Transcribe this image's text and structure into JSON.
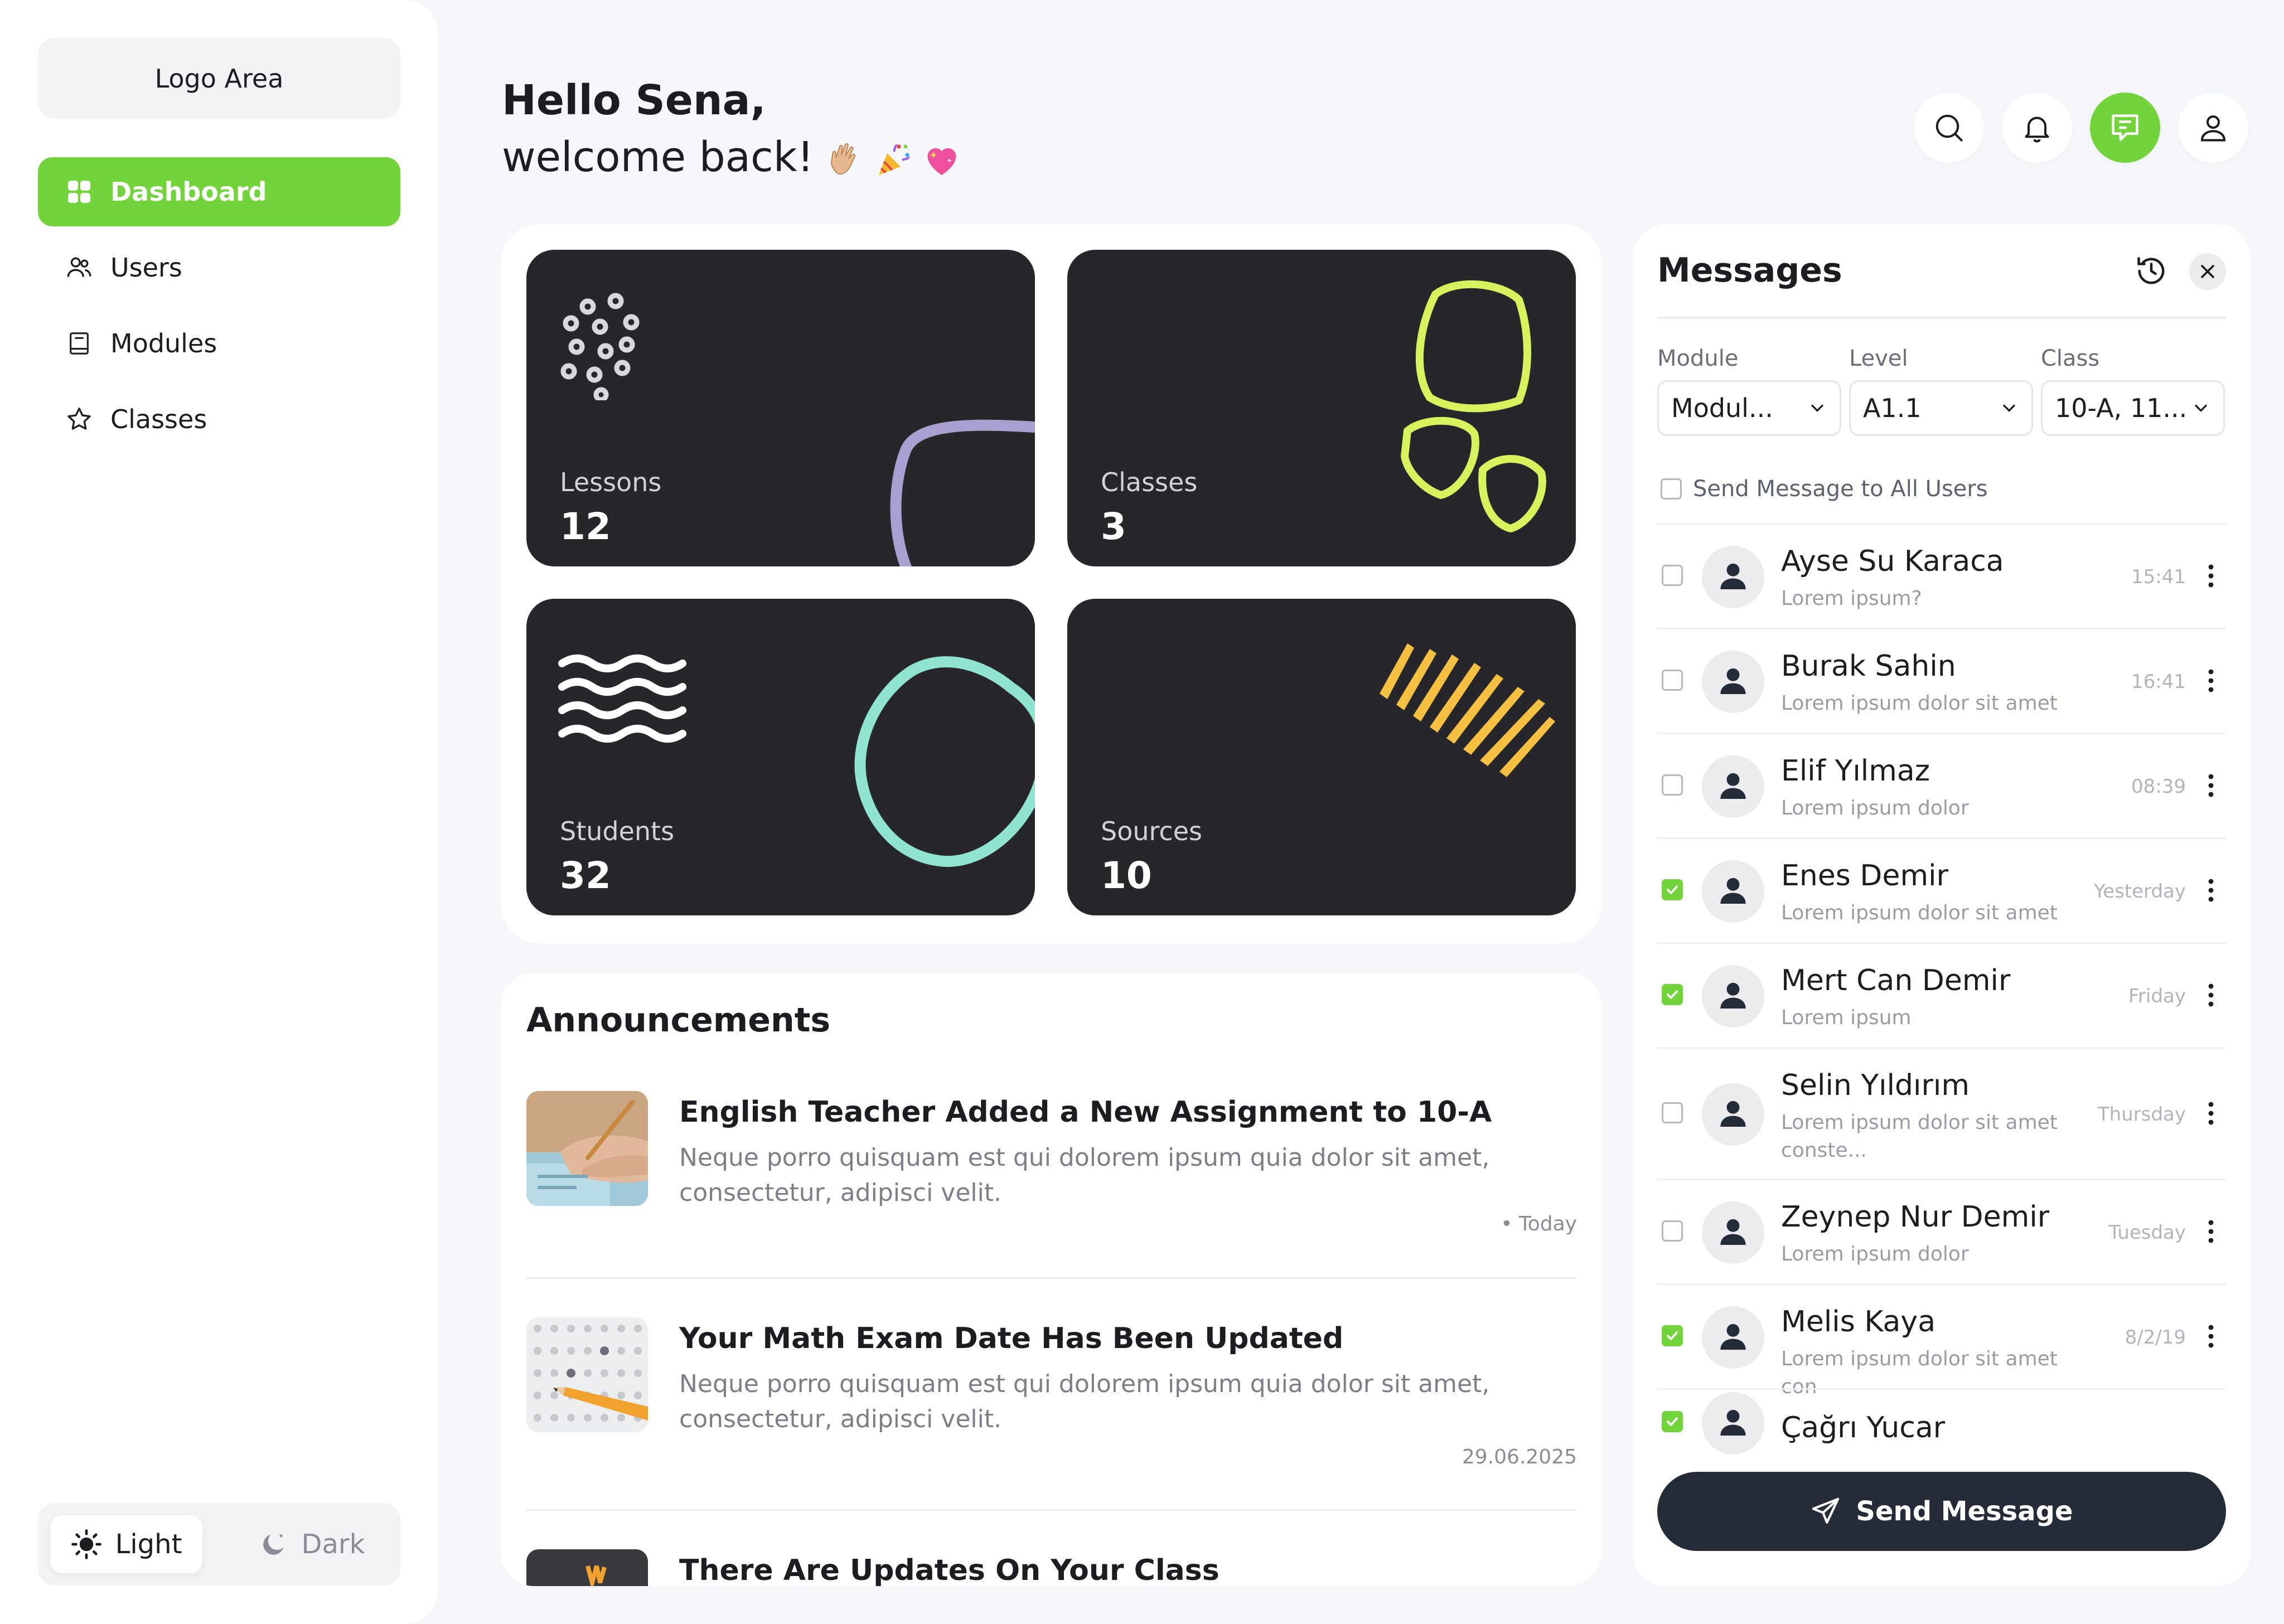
{
  "sidebar": {
    "logo": "Logo Area",
    "items": [
      {
        "label": "Dashboard",
        "icon": "dashboard-icon",
        "active": true
      },
      {
        "label": "Users",
        "icon": "users-icon",
        "active": false
      },
      {
        "label": "Modules",
        "icon": "book-icon",
        "active": false
      },
      {
        "label": "Classes",
        "icon": "star-icon",
        "active": false
      }
    ],
    "theme": {
      "light": "Light",
      "dark": "Dark",
      "selected": "Light"
    }
  },
  "header": {
    "greeting": "Hello Sena,",
    "welcome": "welcome back!",
    "emojis": [
      "waving-hand-icon",
      "party-popper-icon",
      "sparkling-heart-icon"
    ],
    "actions": [
      "search-icon",
      "bell-icon",
      "messages-icon",
      "user-icon"
    ],
    "active_action": "messages-icon"
  },
  "stats": [
    {
      "label": "Lessons",
      "value": "12"
    },
    {
      "label": "Classes",
      "value": "3"
    },
    {
      "label": "Students",
      "value": "32"
    },
    {
      "label": "Sources",
      "value": "10"
    }
  ],
  "announcements": {
    "title": "Announcements",
    "items": [
      {
        "title": "English Teacher Added a New Assignment to 10-A",
        "body": "Neque porro quisquam est qui dolorem ipsum quia dolor sit amet, consectetur, adipisci velit.",
        "date": "Today"
      },
      {
        "title": "Your Math Exam Date Has Been Updated",
        "body": "Neque porro quisquam est qui dolorem ipsum quia dolor sit amet, consectetur, adipisci velit.",
        "date": "29.06.2025"
      },
      {
        "title": "There Are Updates On Your Class",
        "body": "",
        "date": ""
      }
    ]
  },
  "messages": {
    "title": "Messages",
    "filters": {
      "module_label": "Module",
      "module_value": "Modul...",
      "level_label": "Level",
      "level_value": "A1.1",
      "class_label": "Class",
      "class_value": "10-A, 11..."
    },
    "send_all": "Send Message to All Users",
    "items": [
      {
        "name": "Ayse Su Karaca",
        "preview": "Lorem ipsum?",
        "time": "15:41",
        "checked": false
      },
      {
        "name": "Burak Sahin",
        "preview": "Lorem ipsum dolor sit amet",
        "time": "16:41",
        "checked": false
      },
      {
        "name": "Elif Yılmaz",
        "preview": "Lorem ipsum dolor",
        "time": "08:39",
        "checked": false
      },
      {
        "name": "Enes Demir",
        "preview": "Lorem ipsum dolor sit amet",
        "time": "Yesterday",
        "checked": true
      },
      {
        "name": "Mert Can Demir",
        "preview": "Lorem ipsum",
        "time": "Friday",
        "checked": true
      },
      {
        "name": "Selin Yıldırım",
        "preview": "Lorem ipsum dolor sit amet conste...",
        "time": "Thursday",
        "checked": false
      },
      {
        "name": "Zeynep Nur Demir",
        "preview": "Lorem ipsum dolor",
        "time": "Tuesday",
        "checked": false
      },
      {
        "name": "Melis Kaya",
        "preview": "Lorem ipsum dolor sit amet con",
        "time": "8/2/19",
        "checked": true
      },
      {
        "name": "Çağrı Yucar",
        "preview": "",
        "time": "",
        "checked": true
      }
    ],
    "send_button": "Send Message"
  },
  "colors": {
    "accent": "#72d33b",
    "card_bg": "#27272b",
    "send_button_bg": "#262b3a",
    "lessons_shape": "#a99fd0",
    "classes_shape": "#d6f25c",
    "students_shape": "#8fe3cf",
    "sources_shape": "#f6c043"
  }
}
